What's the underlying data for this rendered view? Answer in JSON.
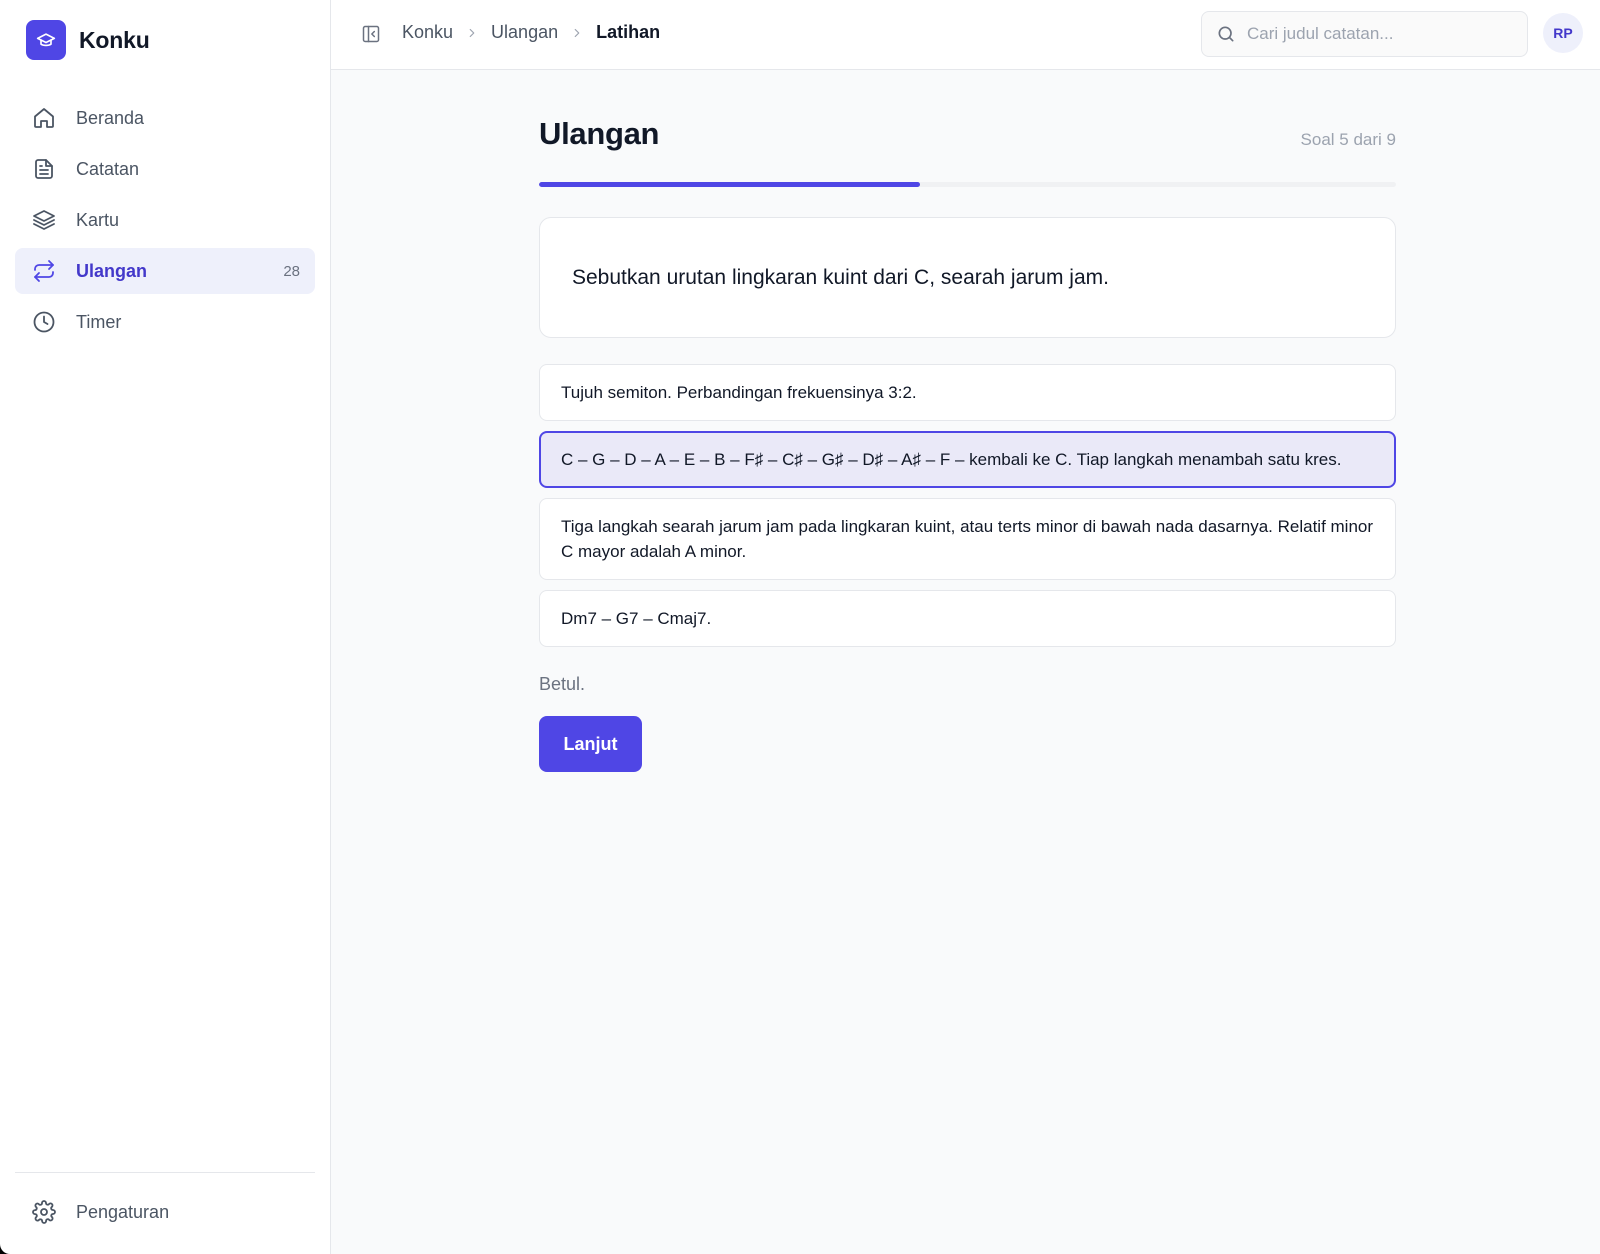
{
  "app": {
    "name": "Konku"
  },
  "sidebar": {
    "items": [
      {
        "label": "Beranda",
        "icon": "home-icon"
      },
      {
        "label": "Catatan",
        "icon": "file-text-icon"
      },
      {
        "label": "Kartu",
        "icon": "layers-icon"
      },
      {
        "label": "Ulangan",
        "icon": "repeat-icon",
        "count": "28",
        "active": true
      },
      {
        "label": "Timer",
        "icon": "clock-icon"
      }
    ],
    "footer": {
      "label": "Pengaturan",
      "icon": "gear-icon"
    }
  },
  "topbar": {
    "breadcrumb": [
      "Konku",
      "Ulangan",
      "Latihan"
    ],
    "search_placeholder": "Cari judul catatan...",
    "avatar_initials": "RP"
  },
  "quiz": {
    "title": "Ulangan",
    "progress_text": "Soal 5 dari 9",
    "progress_fraction": 0.444,
    "question": "Sebutkan urutan lingkaran kuint dari C, searah jarum jam.",
    "options": [
      "Tujuh semiton. Perbandingan frekuensinya 3:2.",
      "C – G – D – A – E – B – F♯ – C♯ – G♯ – D♯ – A♯ – F – kembali ke C. Tiap langkah menambah satu kres.",
      "Tiga langkah searah jarum jam pada lingkaran kuint, atau terts minor di bawah nada dasarnya. Relatif minor C mayor adalah A minor.",
      "Dm7 – G7 – Cmaj7."
    ],
    "selected_option_index": 1,
    "feedback": "Betul.",
    "next_label": "Lanjut"
  },
  "colors": {
    "accent": "#4f46e5",
    "accent_soft": "#eef0fb",
    "background": "#f9fafb"
  }
}
